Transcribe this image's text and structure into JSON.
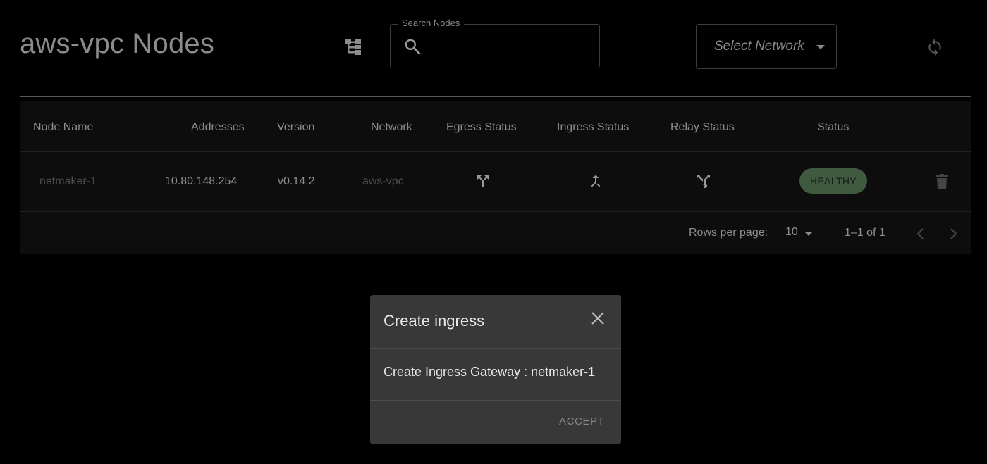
{
  "header": {
    "title": "aws-vpc Nodes",
    "graph_view_icon": "graph-view-icon",
    "search": {
      "legend": "Search Nodes",
      "value": "",
      "placeholder": "",
      "icon": "search-icon"
    },
    "network_select": {
      "value": "Select Network",
      "icon": "arrow-drop-down-icon"
    },
    "refresh_icon": "sync-icon"
  },
  "table": {
    "columns": [
      "Node Name",
      "Addresses",
      "Version",
      "Network",
      "Egress Status",
      "Ingress Status",
      "Relay Status",
      "Status"
    ],
    "rows": [
      {
        "node_name": "netmaker-1",
        "addresses": "10.80.148.254",
        "version": "v0.14.2",
        "network": "aws-vpc",
        "egress_icon": "call-split-icon",
        "ingress_icon": "call-merge-icon",
        "relay_icon": "fork-icon",
        "status": "HEALTHY",
        "delete_icon": "delete-icon"
      }
    ],
    "pagination": {
      "rows_per_page_label": "Rows per page:",
      "rows_per_page": "10",
      "range": "1–1 of 1"
    }
  },
  "dialog": {
    "title": "Create ingress",
    "body": "Create Ingress Gateway : netmaker-1",
    "accept_label": "ACCEPT",
    "close_icon": "close-icon"
  },
  "colors": {
    "background": "#000000",
    "table_background": "#0d0d0d",
    "dialog_background": "#383838",
    "healthy_badge": "#3f5a3f"
  }
}
